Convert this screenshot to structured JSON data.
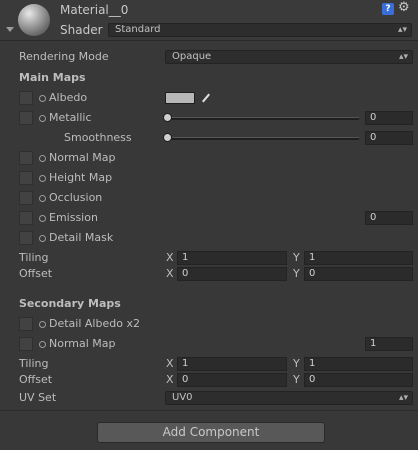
{
  "header": {
    "material_name": "Material__0",
    "shader_label": "Shader",
    "shader_value": "Standard",
    "help_glyph": "?",
    "settings_glyph": "⚙"
  },
  "rendering_mode": {
    "label": "Rendering Mode",
    "value": "Opaque"
  },
  "main_maps": {
    "title": "Main Maps",
    "albedo": {
      "label": "Albedo",
      "color": "#b7b7b7"
    },
    "metallic": {
      "label": "Metallic",
      "value": "0",
      "slider_fraction": 0.0
    },
    "smoothness": {
      "label": "Smoothness",
      "value": "0",
      "slider_fraction": 0.0
    },
    "normal_map": {
      "label": "Normal Map"
    },
    "height_map": {
      "label": "Height Map"
    },
    "occlusion": {
      "label": "Occlusion"
    },
    "emission": {
      "label": "Emission",
      "value": "0"
    },
    "detail_mask": {
      "label": "Detail Mask"
    },
    "tiling": {
      "label": "Tiling",
      "x_label": "X",
      "x": "1",
      "y_label": "Y",
      "y": "1"
    },
    "offset": {
      "label": "Offset",
      "x_label": "X",
      "x": "0",
      "y_label": "Y",
      "y": "0"
    }
  },
  "secondary_maps": {
    "title": "Secondary Maps",
    "detail_albedo": {
      "label": "Detail Albedo x2"
    },
    "normal_map": {
      "label": "Normal Map",
      "value": "1"
    },
    "tiling": {
      "label": "Tiling",
      "x_label": "X",
      "x": "1",
      "y_label": "Y",
      "y": "1"
    },
    "offset": {
      "label": "Offset",
      "x_label": "X",
      "x": "0",
      "y_label": "Y",
      "y": "0"
    },
    "uv_set": {
      "label": "UV Set",
      "value": "UV0"
    }
  },
  "add_component": {
    "label": "Add Component"
  },
  "colors": {
    "background": "#383838",
    "field": "#2b2b2b",
    "accent": "#3a6fd8"
  }
}
